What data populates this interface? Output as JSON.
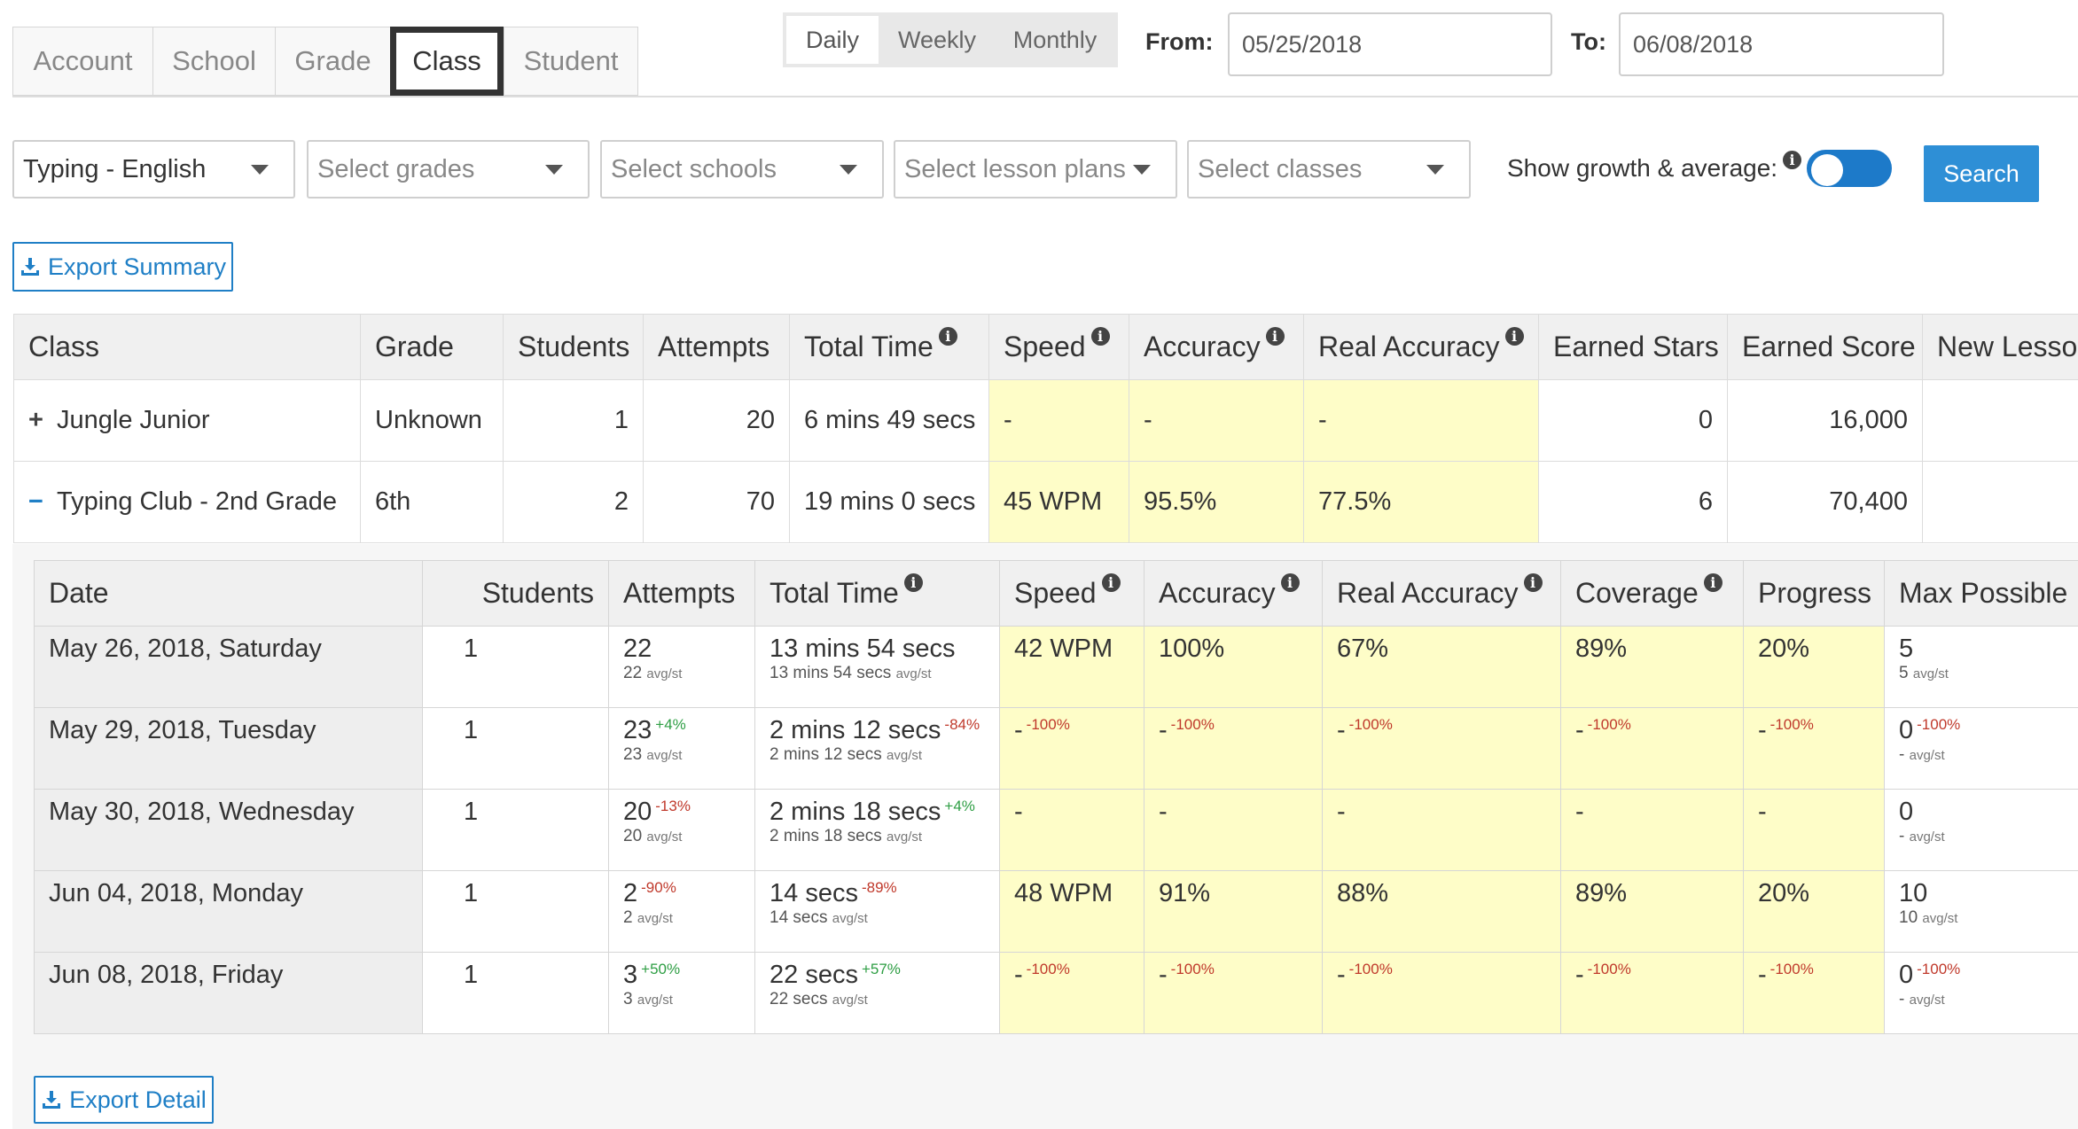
{
  "tabs": [
    {
      "label": "Account",
      "active": false
    },
    {
      "label": "School",
      "active": false
    },
    {
      "label": "Grade",
      "active": false
    },
    {
      "label": "Class",
      "active": true
    },
    {
      "label": "Student",
      "active": false
    }
  ],
  "period": {
    "daily": "Daily",
    "weekly": "Weekly",
    "monthly": "Monthly",
    "selected": "Daily"
  },
  "dates": {
    "from_label": "From:",
    "from_value": "05/25/2018",
    "to_label": "To:",
    "to_value": "06/08/2018"
  },
  "filters": {
    "language": "Typing - English",
    "grades_placeholder": "Select grades",
    "schools_placeholder": "Select schools",
    "lesson_plans_placeholder": "Select lesson plans",
    "classes_placeholder": "Select classes"
  },
  "growth": {
    "label": "Show growth & average:",
    "enabled": true
  },
  "buttons": {
    "search": "Search",
    "export_summary": "Export Summary",
    "export_detail": "Export Detail"
  },
  "icons": {
    "info": "i",
    "info_icon": "info-icon",
    "download_icon": "download-icon",
    "caret_icon": "caret-down-icon",
    "plus_icon": "plus-icon",
    "minus_icon": "minus-icon"
  },
  "colors": {
    "accent": "#2e8fd6",
    "highlight": "#fefdc8",
    "negative": "#c0392b",
    "positive": "#2e9e44"
  },
  "summary": {
    "headers": [
      "Class",
      "Grade",
      "Students",
      "Attempts",
      "Total Time",
      "Speed",
      "Accuracy",
      "Real Accuracy",
      "Earned Stars",
      "Earned Score",
      "New Lesso"
    ],
    "rows": [
      {
        "sign": "+",
        "class": "Jungle Junior",
        "grade": "Unknown",
        "students": "1",
        "attempts": "20",
        "total_time": "6 mins 49 secs",
        "speed": "-",
        "accuracy": "-",
        "real_accuracy": "-",
        "earned_stars": "0",
        "earned_score": "16,000",
        "new_lessons": ""
      },
      {
        "sign": "−",
        "class": "Typing Club - 2nd Grade",
        "grade": "6th",
        "students": "2",
        "attempts": "70",
        "total_time": "19 mins 0 secs",
        "speed": "45 WPM",
        "accuracy": "95.5%",
        "real_accuracy": "77.5%",
        "earned_stars": "6",
        "earned_score": "70,400",
        "new_lessons": ""
      }
    ]
  },
  "detail": {
    "headers": [
      "Date",
      "Students",
      "Attempts",
      "Total Time",
      "Speed",
      "Accuracy",
      "Real Accuracy",
      "Coverage",
      "Progress",
      "Max Possible :"
    ],
    "avg_label": "avg/st",
    "rows": [
      {
        "date": "May 26, 2018, Saturday",
        "students": "1",
        "attempts": "22",
        "attempts_pct": "",
        "attempts_avg": "22",
        "total_time": "13 mins 54 secs",
        "total_time_pct": "",
        "total_time_avg": "13 mins 54 secs",
        "speed": "42 WPM",
        "speed_pct": "",
        "accuracy": "100%",
        "accuracy_pct": "",
        "real_accuracy": "67%",
        "real_accuracy_pct": "",
        "coverage": "89%",
        "coverage_pct": "",
        "progress": "20%",
        "progress_pct": "",
        "max": "5",
        "max_pct": "",
        "max_avg": "5"
      },
      {
        "date": "May 29, 2018, Tuesday",
        "students": "1",
        "attempts": "23",
        "attempts_pct": "+4%",
        "attempts_avg": "23",
        "total_time": "2 mins 12 secs",
        "total_time_pct": "-84%",
        "total_time_avg": "2 mins 12 secs",
        "speed": "-",
        "speed_pct": "-100%",
        "accuracy": "-",
        "accuracy_pct": "-100%",
        "real_accuracy": "-",
        "real_accuracy_pct": "-100%",
        "coverage": "-",
        "coverage_pct": "-100%",
        "progress": "-",
        "progress_pct": "-100%",
        "max": "0",
        "max_pct": "-100%",
        "max_avg": "-"
      },
      {
        "date": "May 30, 2018, Wednesday",
        "students": "1",
        "attempts": "20",
        "attempts_pct": "-13%",
        "attempts_avg": "20",
        "total_time": "2 mins 18 secs",
        "total_time_pct": "+4%",
        "total_time_avg": "2 mins 18 secs",
        "speed": "-",
        "speed_pct": "",
        "accuracy": "-",
        "accuracy_pct": "",
        "real_accuracy": "-",
        "real_accuracy_pct": "",
        "coverage": "-",
        "coverage_pct": "",
        "progress": "-",
        "progress_pct": "",
        "max": "0",
        "max_pct": "",
        "max_avg": "-"
      },
      {
        "date": "Jun 04, 2018, Monday",
        "students": "1",
        "attempts": "2",
        "attempts_pct": "-90%",
        "attempts_avg": "2",
        "total_time": "14 secs",
        "total_time_pct": "-89%",
        "total_time_avg": "14 secs",
        "speed": "48 WPM",
        "speed_pct": "",
        "accuracy": "91%",
        "accuracy_pct": "",
        "real_accuracy": "88%",
        "real_accuracy_pct": "",
        "coverage": "89%",
        "coverage_pct": "",
        "progress": "20%",
        "progress_pct": "",
        "max": "10",
        "max_pct": "",
        "max_avg": "10"
      },
      {
        "date": "Jun 08, 2018, Friday",
        "students": "1",
        "attempts": "3",
        "attempts_pct": "+50%",
        "attempts_avg": "3",
        "total_time": "22 secs",
        "total_time_pct": "+57%",
        "total_time_avg": "22 secs",
        "speed": "-",
        "speed_pct": "-100%",
        "accuracy": "-",
        "accuracy_pct": "-100%",
        "real_accuracy": "-",
        "real_accuracy_pct": "-100%",
        "coverage": "-",
        "coverage_pct": "-100%",
        "progress": "-",
        "progress_pct": "-100%",
        "max": "0",
        "max_pct": "-100%",
        "max_avg": "-"
      }
    ]
  }
}
